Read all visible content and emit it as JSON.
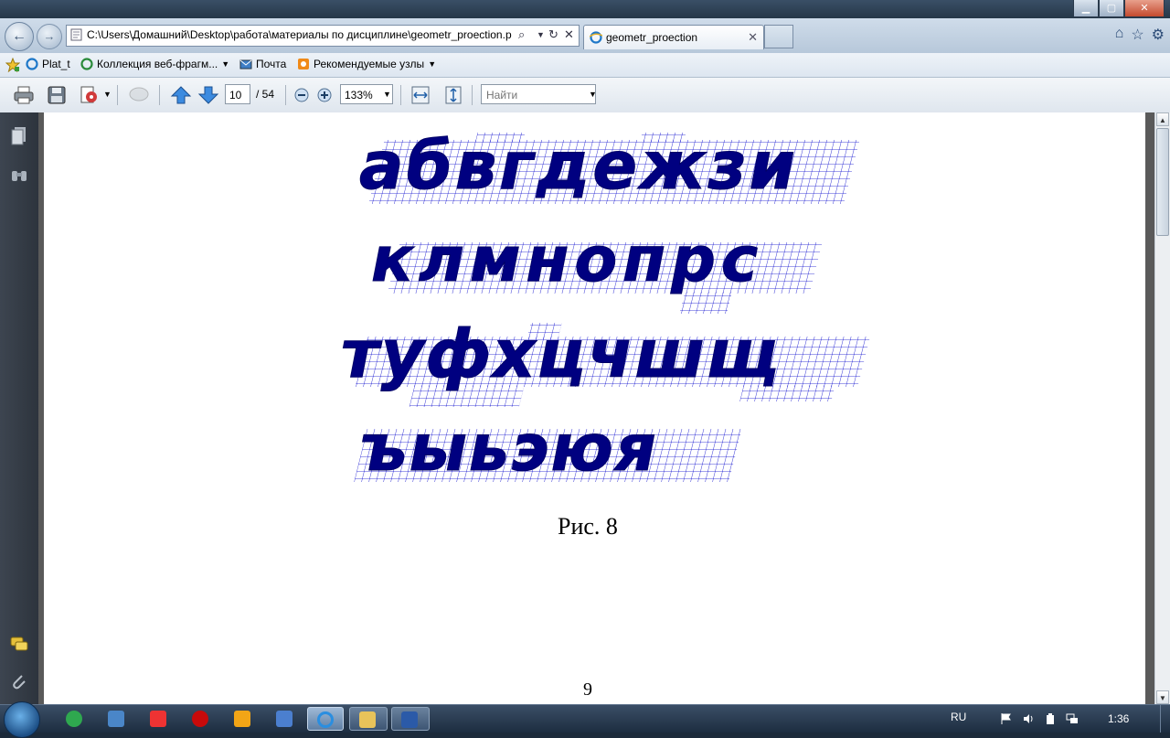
{
  "window": {
    "minimize_icon": "minimize-icon",
    "maximize_icon": "maximize-icon",
    "close_icon": "close-icon"
  },
  "browser": {
    "address_url": "C:\\Users\\Домашний\\Desktop\\работа\\материалы по дисциплине\\geometr_proection.p",
    "tab_title": "geometr_proection",
    "favorites": [
      {
        "label": "Plat_t"
      },
      {
        "label": "Коллекция веб-фрагм..."
      },
      {
        "label": "Почта"
      },
      {
        "label": "Рекомендуемые узлы"
      }
    ]
  },
  "pdf_toolbar": {
    "current_page": "10",
    "total_pages": "/ 54",
    "zoom": "133%",
    "search_placeholder": "Найти"
  },
  "document": {
    "rows": [
      {
        "letters": "абвгдежзи"
      },
      {
        "letters": "клмнопрс"
      },
      {
        "letters": "туфхцчшщ"
      },
      {
        "letters": "ъыьэюя"
      }
    ],
    "caption": "Рис. 8",
    "page_number": "9"
  },
  "taskbar": {
    "language": "RU",
    "time": "1:36"
  },
  "colors": {
    "grid_blue": "#0000cc",
    "letter_navy": "#000080"
  }
}
